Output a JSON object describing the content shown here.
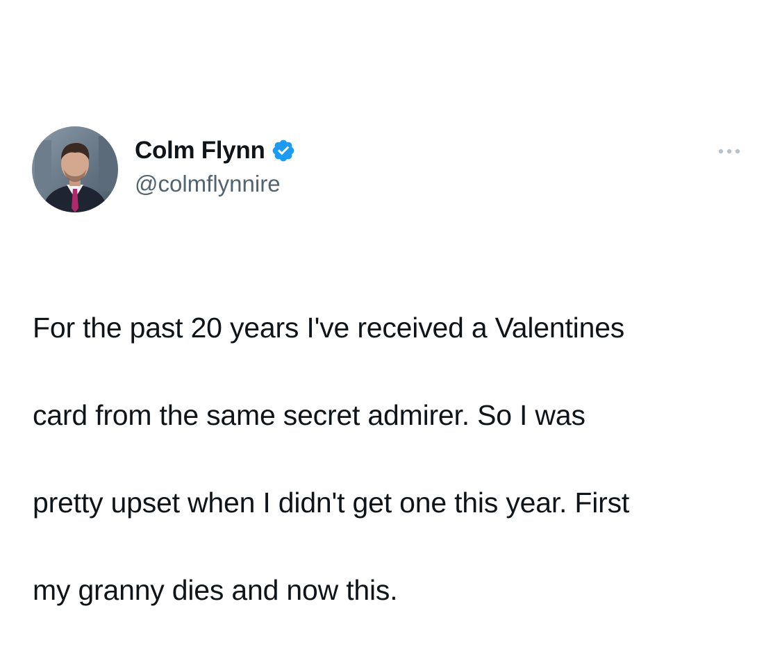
{
  "tweet": {
    "author": {
      "display_name": "Colm Flynn",
      "handle": "@colmflynnire",
      "verified": true,
      "avatar_icon": "profile-photo"
    },
    "more_icon": "more-horizontal-icon",
    "text_lines": [
      "For the past 20 years I've received a Valentines",
      "card from the same secret admirer. So I was",
      "pretty upset when I didn't get one this year. First",
      "my granny dies and now this."
    ]
  },
  "colors": {
    "text": "#0f1419",
    "secondary_text": "#536471",
    "verified_badge": "#1d9bf0",
    "background": "#ffffff"
  }
}
